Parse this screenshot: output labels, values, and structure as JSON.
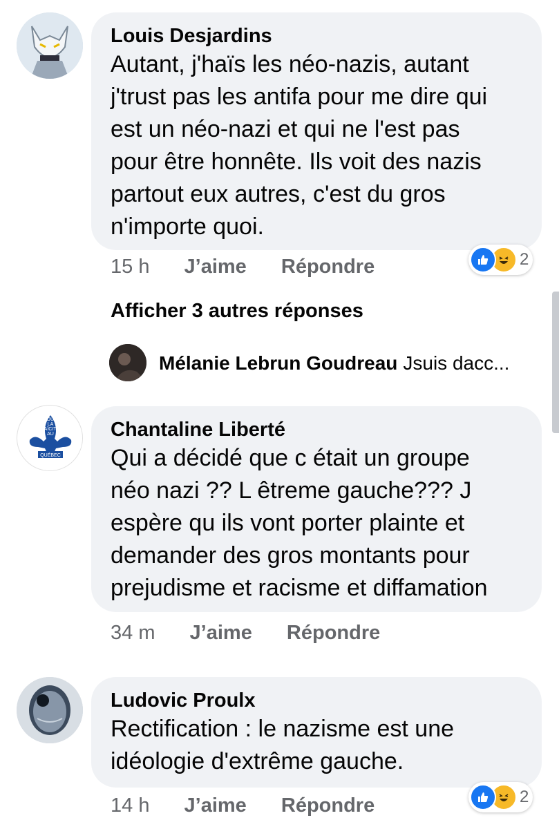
{
  "comments": [
    {
      "author": "Louis Desjardins",
      "text": "Autant, j'haïs les néo-nazis, autant\nj'trust pas les antifa pour me dire qui\nest un néo-nazi et qui ne l'est pas\npour être honnête. Ils voit des nazis\npartout eux autres, c'est du gros\nn'importe quoi.",
      "time": "15 h",
      "like_label": "J’aime",
      "reply_label": "Répondre",
      "reaction_count": "2",
      "reaction_icons": [
        "like-icon",
        "haha-icon"
      ],
      "more_replies": "Afficher 3 autres réponses",
      "reply_preview": {
        "author": "Mélanie Lebrun Goudreau",
        "text": "Jsuis dacc..."
      }
    },
    {
      "author": "Chantaline Liberté",
      "avatar_text": [
        "POUR",
        "LA",
        "LAÏCITÉ",
        "AU",
        "QUÉBEC"
      ],
      "text": "Qui a décidé que c était un groupe\nnéo nazi ?? L êtreme gauche??? J\nespère qu ils vont porter plainte et\ndemander des gros montants pour\nprejudisme et racisme et diffamation",
      "time": "34 m",
      "like_label": "J’aime",
      "reply_label": "Répondre"
    },
    {
      "author": "Ludovic Proulx",
      "text": "Rectification : le nazisme est une\nidéologie d'extrême gauche.",
      "time": "14 h",
      "like_label": "J’aime",
      "reply_label": "Répondre",
      "reaction_count": "2",
      "reaction_icons": [
        "like-icon",
        "haha-icon"
      ]
    }
  ],
  "colors": {
    "bubble": "#f0f2f5",
    "meta_text": "#65676b",
    "like_blue": "#1877f2",
    "haha_yellow": "#f7b928",
    "quebec_blue": "#1b4fa0"
  }
}
